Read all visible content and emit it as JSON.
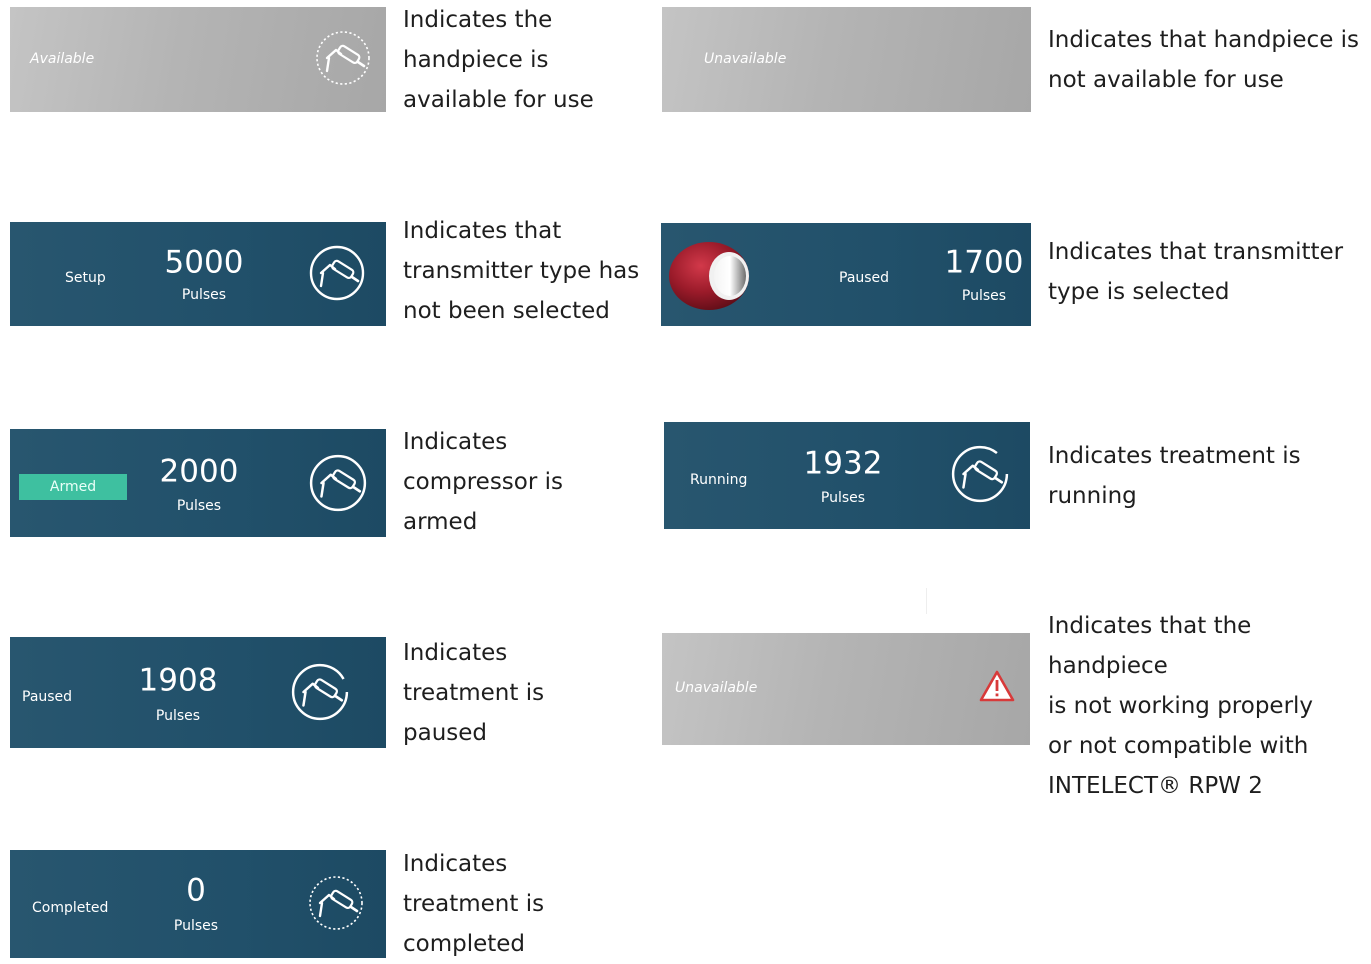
{
  "left_column": [
    {
      "status": "Available",
      "description": [
        "Indicates the",
        "handpiece is",
        "available for use"
      ]
    },
    {
      "status": "Setup",
      "pulses": "5000",
      "unit": "Pulses",
      "description": [
        "Indicates that",
        "transmitter type has",
        "not been selected"
      ]
    },
    {
      "status": "Armed",
      "pulses": "2000",
      "unit": "Pulses",
      "description": [
        "Indicates",
        "compressor is",
        "armed"
      ]
    },
    {
      "status": "Paused",
      "pulses": "1908",
      "unit": "Pulses",
      "description": [
        "Indicates",
        "treatment is",
        "paused"
      ]
    },
    {
      "status": "Completed",
      "pulses": "0",
      "unit": "Pulses",
      "description": [
        "Indicates",
        "treatment is",
        "completed"
      ]
    }
  ],
  "right_column": [
    {
      "status": "Unavailable",
      "description": [
        "Indicates that handpiece is",
        "not available for use"
      ]
    },
    {
      "status": "Paused",
      "pulses": "1700",
      "unit": "Pulses",
      "description": [
        "Indicates that transmitter",
        "type is selected"
      ]
    },
    {
      "status": "Running",
      "pulses": "1932",
      "unit": "Pulses",
      "description": [
        "Indicates treatment is",
        "running"
      ]
    },
    {
      "status": "Unavailable",
      "description": [
        "Indicates that the handpiece",
        "is not working properly",
        "or not compatible with",
        "INTELECT® RPW 2"
      ]
    }
  ],
  "colors": {
    "panel_blue": "#21506a",
    "panel_gray": "#b4b4b4",
    "armed_badge": "#3ec0a0",
    "transmitter_red": "#9b1b2a",
    "warning_red": "#d83a3a"
  },
  "icons": {
    "handpiece": "handpiece-icon",
    "warning": "warning-triangle-icon",
    "transmitter": "transmitter-cap-icon"
  }
}
